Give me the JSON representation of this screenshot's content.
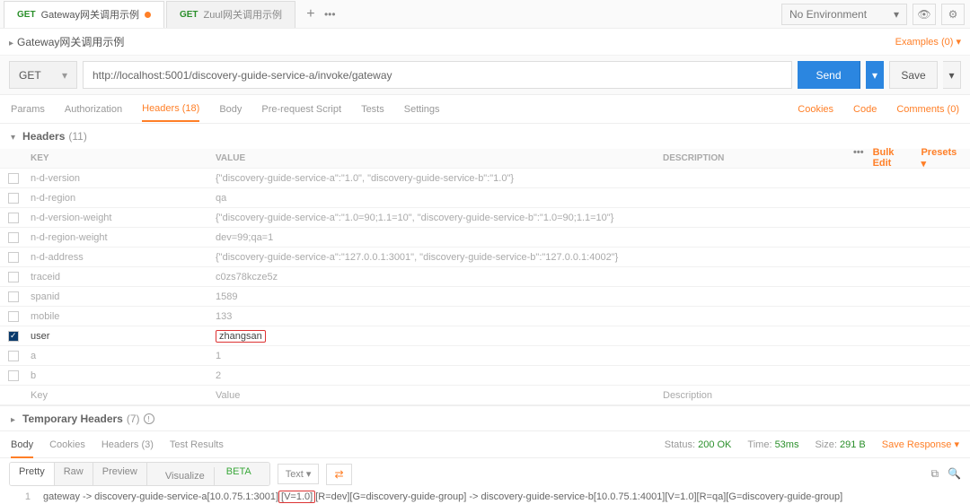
{
  "tabs": {
    "active": "Gateway网关调用示例",
    "inactive": "Zuul网关调用示例",
    "method": "GET"
  },
  "env": {
    "selected": "No Environment"
  },
  "title": "Gateway网关调用示例",
  "examples": "Examples (0) ▾",
  "request": {
    "method": "GET",
    "url": "http://localhost:5001/discovery-guide-service-a/invoke/gateway",
    "send": "Send",
    "save": "Save"
  },
  "reqtabs": {
    "params": "Params",
    "auth": "Authorization",
    "headers": "Headers (18)",
    "body": "Body",
    "prereq": "Pre-request Script",
    "tests": "Tests",
    "settings": "Settings",
    "cookies": "Cookies",
    "code": "Code",
    "comments": "Comments (0)"
  },
  "headers_section": {
    "title": "Headers",
    "count": "(11)",
    "temp_title": "Temporary Headers",
    "temp_count": "(7)"
  },
  "grid": {
    "cols": {
      "key": "KEY",
      "value": "VALUE",
      "desc": "DESCRIPTION",
      "bulk": "Bulk Edit",
      "presets": "Presets ▾"
    },
    "rows": [
      {
        "key": "n-d-version",
        "val": "{\"discovery-guide-service-a\":\"1.0\", \"discovery-guide-service-b\":\"1.0\"}",
        "checked": false
      },
      {
        "key": "n-d-region",
        "val": "qa",
        "checked": false
      },
      {
        "key": "n-d-version-weight",
        "val": "{\"discovery-guide-service-a\":\"1.0=90;1.1=10\", \"discovery-guide-service-b\":\"1.0=90;1.1=10\"}",
        "checked": false
      },
      {
        "key": "n-d-region-weight",
        "val": "dev=99;qa=1",
        "checked": false
      },
      {
        "key": "n-d-address",
        "val": "{\"discovery-guide-service-a\":\"127.0.0.1:3001\", \"discovery-guide-service-b\":\"127.0.0.1:4002\"}",
        "checked": false
      },
      {
        "key": "traceid",
        "val": "c0zs78kcze5z",
        "checked": false
      },
      {
        "key": "spanid",
        "val": "1589",
        "checked": false
      },
      {
        "key": "mobile",
        "val": "133",
        "checked": false
      },
      {
        "key": "user",
        "val": "zhangsan",
        "checked": true,
        "highlight": true
      },
      {
        "key": "a",
        "val": "1",
        "checked": false
      },
      {
        "key": "b",
        "val": "2",
        "checked": false
      }
    ],
    "placeholder": {
      "key": "Key",
      "value": "Value",
      "desc": "Description"
    }
  },
  "response": {
    "tabs": {
      "body": "Body",
      "cookies": "Cookies",
      "headers": "Headers (3)",
      "tests": "Test Results"
    },
    "status_lbl": "Status:",
    "status": "200 OK",
    "time_lbl": "Time:",
    "time": "53ms",
    "size_lbl": "Size:",
    "size": "291 B",
    "save": "Save Response ▾"
  },
  "viewer": {
    "pretty": "Pretty",
    "raw": "Raw",
    "preview": "Preview",
    "visualize": "Visualize",
    "beta": "BETA",
    "text": "Text ▾"
  },
  "code": {
    "line_num": "1",
    "pre": "gateway -> discovery-guide-service-a[10.0.75.1:3001]",
    "hl": "[V=1.0]",
    "post": "[R=dev][G=discovery-guide-group] -> discovery-guide-service-b[10.0.75.1:4001][V=1.0][R=qa][G=discovery-guide-group]"
  }
}
